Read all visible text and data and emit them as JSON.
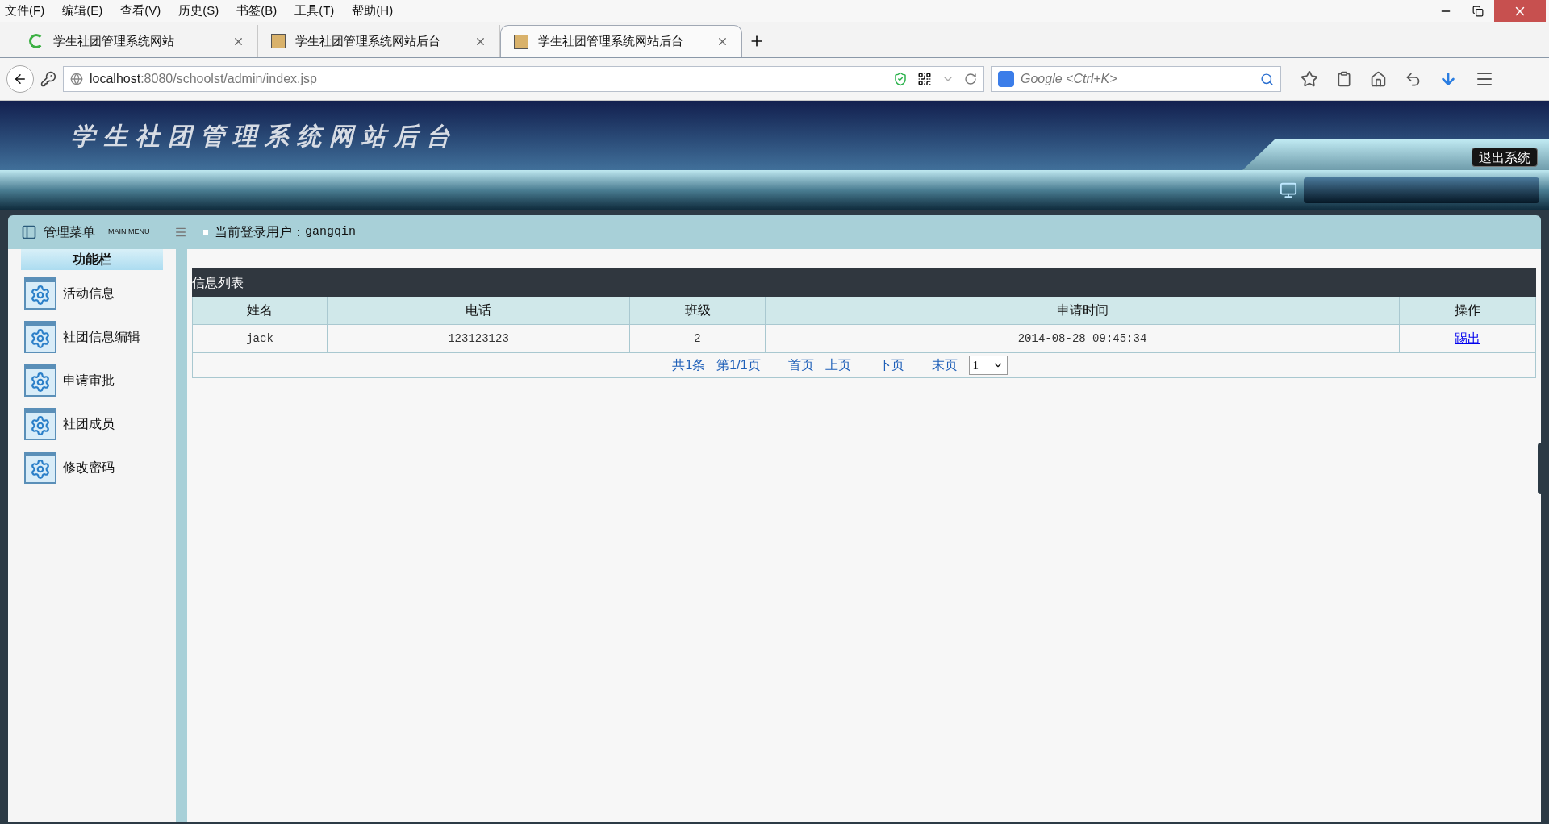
{
  "menu_bar": [
    "文件(F)",
    "编辑(E)",
    "查看(V)",
    "历史(S)",
    "书签(B)",
    "工具(T)",
    "帮助(H)"
  ],
  "tabs": [
    {
      "title": "学生社团管理系统网站",
      "kind": "loading",
      "selected": false
    },
    {
      "title": "学生社团管理系统网站后台",
      "kind": "page",
      "selected": false
    },
    {
      "title": "学生社团管理系统网站后台",
      "kind": "page",
      "selected": true
    }
  ],
  "address_bar": {
    "host": "localhost",
    "path": ":8080/schoolst/admin/index.jsp"
  },
  "search": {
    "placeholder": "Google <Ctrl+K>"
  },
  "header": {
    "title": "学生社团管理系统网站后台",
    "exit_button": "退出系统"
  },
  "sidebar": {
    "title": "管理菜单",
    "subtitle": "MAIN MENU",
    "section": "功能栏",
    "items": [
      "活动信息",
      "社团信息编辑",
      "申请审批",
      "社团成员",
      "修改密码"
    ]
  },
  "user_bar": {
    "label": "当前登录用户：",
    "user": "gangqin"
  },
  "table": {
    "title": "信息列表",
    "columns": [
      "姓名",
      "电话",
      "班级",
      "申请时间",
      "操作"
    ],
    "rows": [
      {
        "cells": [
          "jack",
          "123123123",
          "2",
          "2014-08-28 09:45:34"
        ],
        "action": "踢出"
      }
    ],
    "pagination": {
      "total": "共1条",
      "page": "第1/1页",
      "links": [
        "首页",
        "上页",
        "下页",
        "末页"
      ],
      "select": "1"
    }
  }
}
